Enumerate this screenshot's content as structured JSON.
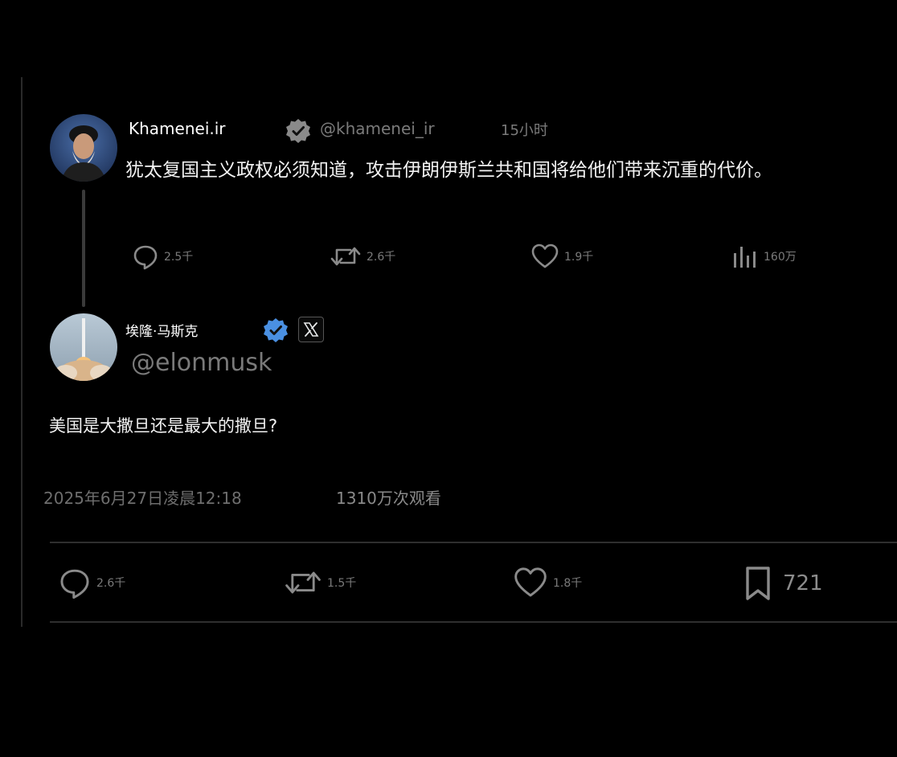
{
  "quoted_tweet": {
    "author_name": "Khamenei.ir",
    "handle": "@khamenei_ir",
    "time": "15小时",
    "text": "犹太复国主义政权必须知道，攻击伊朗伊斯兰共和国将给他们带来沉重的代价。",
    "actions": {
      "replies": "2.5千",
      "retweets": "2.6千",
      "likes": "1.9千",
      "views": "160万"
    }
  },
  "main_tweet": {
    "author_name": "埃隆·马斯克",
    "handle": "@elonmusk",
    "text": "美国是大撒旦还是最大的撒旦?",
    "timestamp": "2025年6月27日凌晨12:18",
    "views": "1310万次观看",
    "actions": {
      "replies": "2.6千",
      "retweets": "1.5千",
      "likes": "1.8千",
      "bookmarks": "721"
    }
  },
  "colors": {
    "background": "#000000",
    "text": "#f2f2f2",
    "muted": "#7a7a7a",
    "verified_blue": "#4a90e2",
    "verified_gray": "#8a8a8a"
  }
}
